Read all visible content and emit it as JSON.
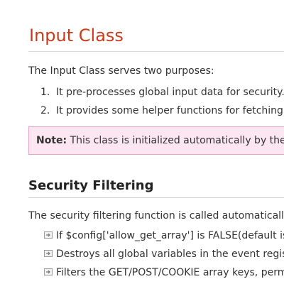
{
  "title": "Input Class",
  "intro": "The Input Class serves two purposes:",
  "ordered_list": [
    {
      "num": "1.",
      "text": "It pre-processes global input data for security."
    },
    {
      "num": "2.",
      "text": "It provides some helper functions for fetching i"
    }
  ],
  "note": {
    "label": "Note:",
    "text": " This class is initialized automatically by the sy"
  },
  "section": {
    "heading": "Security Filtering",
    "paragraph": "The security filtering function is called automatically w",
    "bullets": [
      "If $config['allow_get_array'] is FALSE(default is T",
      "Destroys all global variables in the event registe",
      "Filters the GET/POST/COOKIE array keys, permi"
    ]
  },
  "colors": {
    "title": "#c93b1b",
    "note_bg": "#fbe6f1",
    "note_border": "#e8a7c8",
    "bullet_icon": "#888888"
  },
  "icons": {
    "bullet": "arrow-bullet-icon"
  }
}
